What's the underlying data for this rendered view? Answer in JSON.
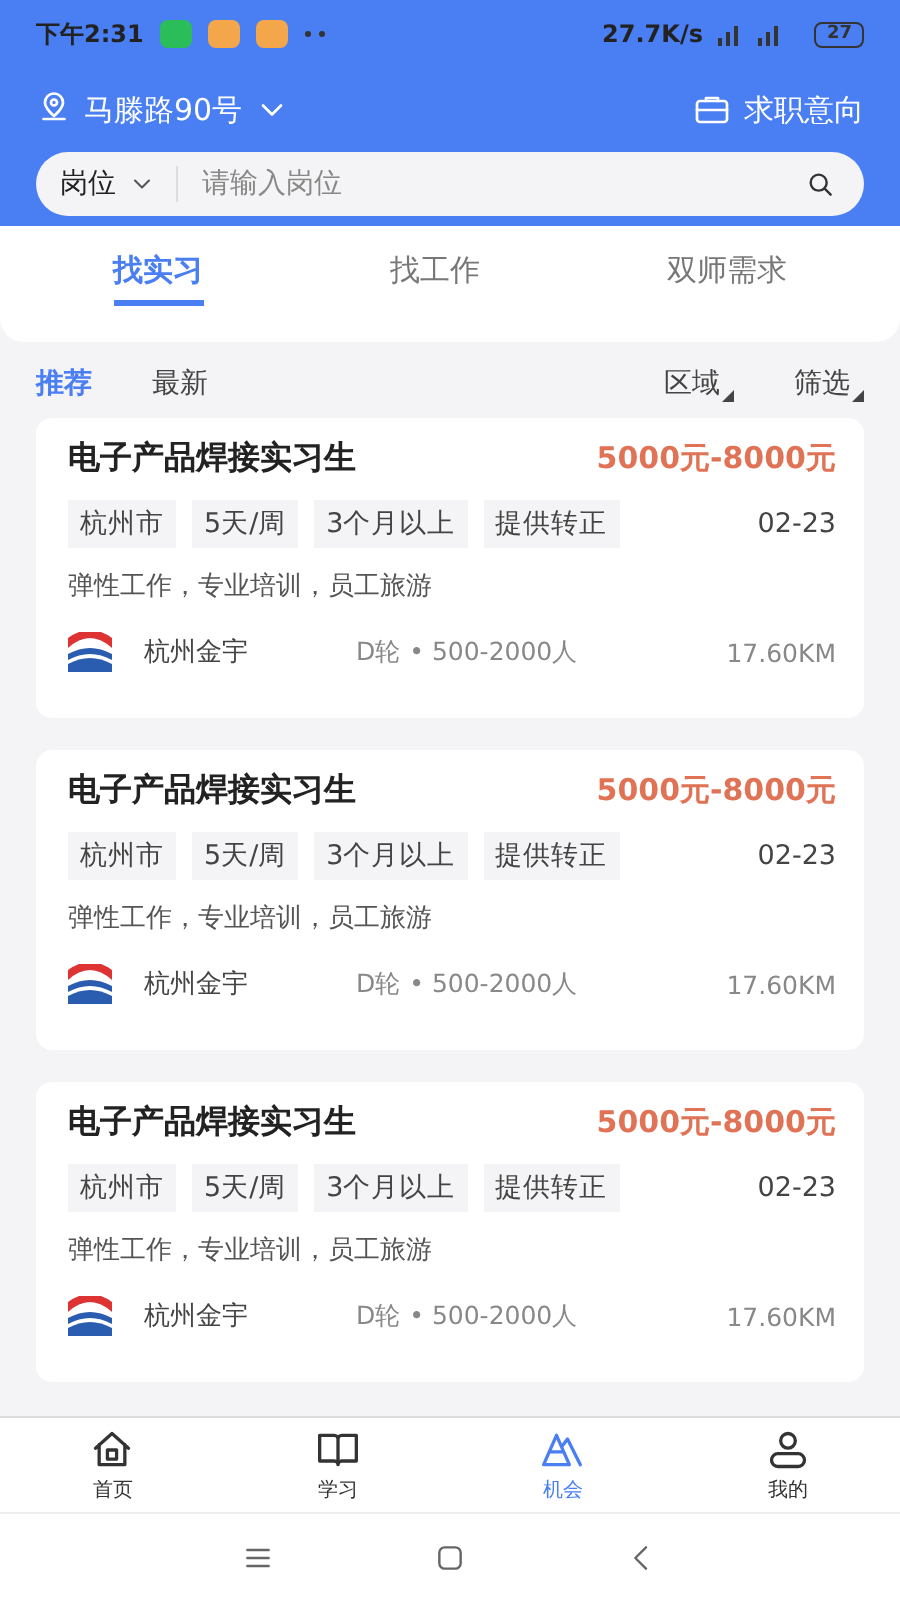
{
  "status_bar": {
    "time": "下午2:31",
    "speed": "27.7K/s",
    "battery": "27"
  },
  "header": {
    "location": "马滕路90号",
    "intent": "求职意向"
  },
  "search": {
    "category": "岗位",
    "placeholder": "请输入岗位"
  },
  "tabs": [
    {
      "label": "找实习",
      "selected": true
    },
    {
      "label": "找工作",
      "selected": false
    },
    {
      "label": "双师需求",
      "selected": false
    }
  ],
  "sort": [
    {
      "label": "推荐",
      "selected": true
    },
    {
      "label": "最新",
      "selected": false
    }
  ],
  "filters": [
    "区域",
    "筛选"
  ],
  "jobs": [
    {
      "title": "电子产品焊接实习生",
      "salary": "5000元-8000元",
      "tags": [
        "杭州市",
        "5天/周",
        "3个月以上",
        "提供转正"
      ],
      "date": "02-23",
      "benefits": "弹性工作，专业培训，员工旅游",
      "company": "杭州金宇",
      "info": "D轮 • 500-2000人",
      "distance": "17.60KM"
    },
    {
      "title": "电子产品焊接实习生",
      "salary": "5000元-8000元",
      "tags": [
        "杭州市",
        "5天/周",
        "3个月以上",
        "提供转正"
      ],
      "date": "02-23",
      "benefits": "弹性工作，专业培训，员工旅游",
      "company": "杭州金宇",
      "info": "D轮 • 500-2000人",
      "distance": "17.60KM"
    },
    {
      "title": "电子产品焊接实习生",
      "salary": "5000元-8000元",
      "tags": [
        "杭州市",
        "5天/周",
        "3个月以上",
        "提供转正"
      ],
      "date": "02-23",
      "benefits": "弹性工作，专业培训，员工旅游",
      "company": "杭州金宇",
      "info": "D轮 • 500-2000人",
      "distance": "17.60KM"
    }
  ],
  "bottom_nav": [
    {
      "label": "首页",
      "selected": false
    },
    {
      "label": "学习",
      "selected": false
    },
    {
      "label": "机会",
      "selected": true
    },
    {
      "label": "我的",
      "selected": false
    }
  ]
}
